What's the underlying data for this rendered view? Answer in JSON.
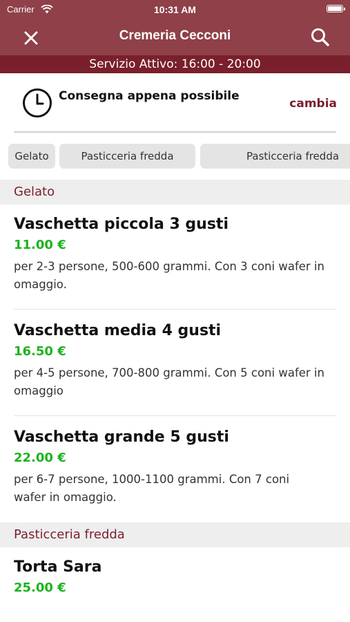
{
  "status_bar": {
    "carrier": "Carrier",
    "time": "10:31 AM"
  },
  "nav": {
    "title": "Cremeria Cecconi"
  },
  "service_banner": "Servizio Attivo: 16:00 - 20:00",
  "delivery": {
    "label": "Consegna appena possibile",
    "change_label": "cambia"
  },
  "category_tabs": [
    {
      "label": "Gelato"
    },
    {
      "label": "Pasticceria fredda"
    },
    {
      "label": "Pasticceria fredda"
    }
  ],
  "sections": [
    {
      "title": "Gelato",
      "products": [
        {
          "name": "Vaschetta piccola 3 gusti",
          "price": "11.00 €",
          "description": "per 2-3 persone, 500-600 grammi. Con 3 coni wafer in omaggio."
        },
        {
          "name": "Vaschetta media 4 gusti",
          "price": "16.50 €",
          "description": "per 4-5 persone, 700-800 grammi. Con 5 coni wafer in omaggio"
        },
        {
          "name": "Vaschetta grande 5 gusti",
          "price": "22.00 €",
          "description": "per 6-7 persone, 1000-1100 grammi. Con 7 coni wafer in omaggio."
        }
      ]
    },
    {
      "title": "Pasticceria fredda",
      "products": [
        {
          "name": "Torta Sara",
          "price": "25.00 €"
        }
      ]
    }
  ],
  "colors": {
    "brand": "#8f4049",
    "banner": "#7a1f2c",
    "price": "#1db31d",
    "section_header_bg": "#eeeeee"
  },
  "icons": {
    "close": "close-icon",
    "search": "search-icon",
    "clock": "clock-icon",
    "wifi": "wifi-icon",
    "battery": "battery-icon"
  }
}
